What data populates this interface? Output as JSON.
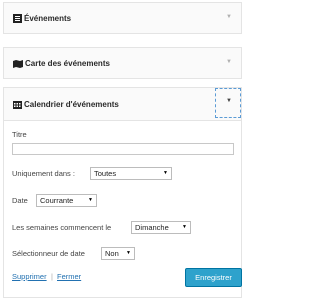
{
  "widgets": [
    {
      "title": "Événements",
      "icon": "list-icon"
    },
    {
      "title": "Carte des événements",
      "icon": "map-icon"
    },
    {
      "title": "Calendrier d'événements",
      "icon": "calendar-icon"
    }
  ],
  "form": {
    "titre_label": "Titre",
    "titre_value": "",
    "uniquement_label": "Uniquement dans :",
    "uniquement_value": "Toutes",
    "date_label": "Date",
    "date_value": "Courrante",
    "semaines_label": "Les semaines commencent le",
    "semaines_value": "Dimanche",
    "selecteur_label": "Sélectionneur de date",
    "selecteur_value": "Non"
  },
  "links": {
    "supprimer": "Supprimer",
    "separator": "|",
    "fermer": "Fermer"
  },
  "save_button": "Enregistrer"
}
